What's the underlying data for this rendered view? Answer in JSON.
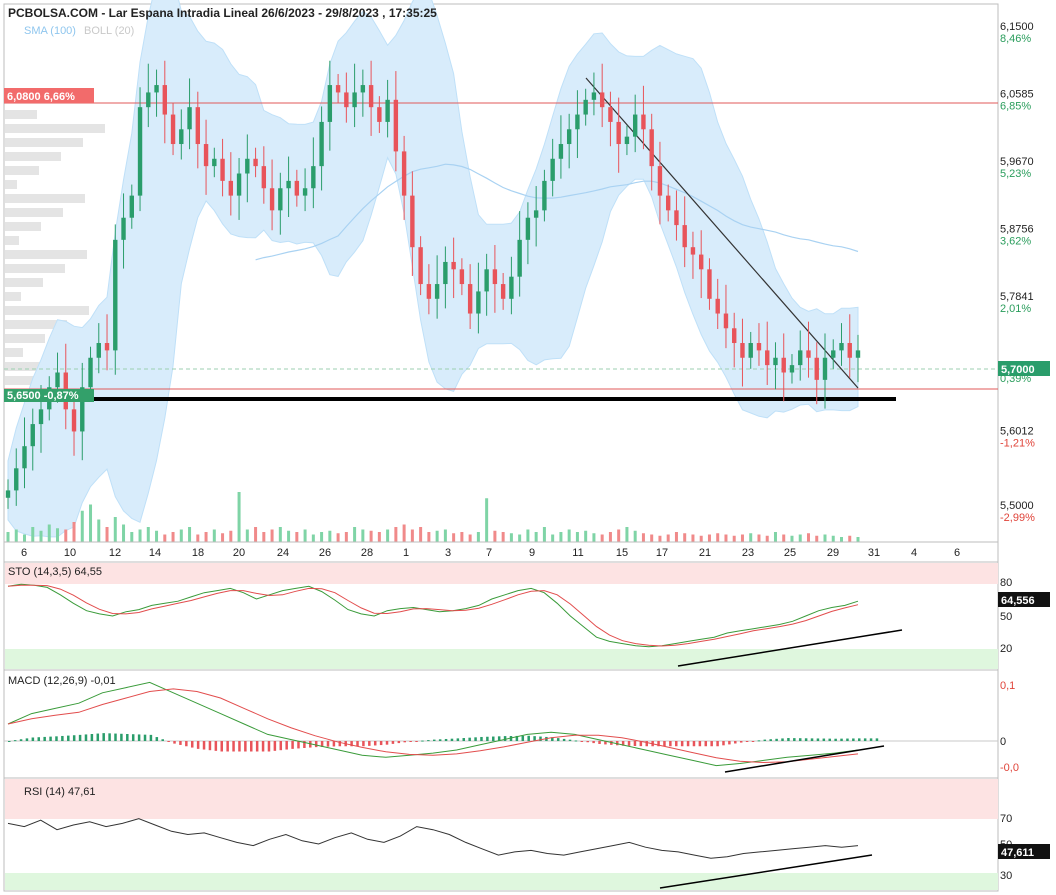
{
  "header": {
    "title": "PCBOLSA.COM - Lar Espana Intradia Lineal 26/6/2023 - 29/8/2023 , 17:35:25",
    "legend_sma": "SMA (100)",
    "legend_boll": "BOLL (20)"
  },
  "colors": {
    "up": "#2a9d6b",
    "down": "#e8545a",
    "band": "#d8ecfb",
    "sma": "#a9d2f2",
    "level": "#e05a5a",
    "label_red": "#f26b6b",
    "label_green": "#33a06a"
  },
  "left_labels": {
    "resistance": "6,0800  6,66%",
    "support": "5,6500  -0,87%"
  },
  "last_price": "5,7000",
  "last_price_pct": "0,39%",
  "price_axis": [
    {
      "v": 6.15,
      "label": "6,1500",
      "pct": "8,46%",
      "sign": "pos"
    },
    {
      "v": 6.0585,
      "label": "6,0585",
      "pct": "6,85%",
      "sign": "pos"
    },
    {
      "v": 5.967,
      "label": "5,9670",
      "pct": "5,23%",
      "sign": "pos"
    },
    {
      "v": 5.8756,
      "label": "5,8756",
      "pct": "3,62%",
      "sign": "pos"
    },
    {
      "v": 5.7841,
      "label": "5,7841",
      "pct": "2,01%",
      "sign": "pos"
    },
    {
      "v": 5.6012,
      "label": "5,6012",
      "pct": "-1,21%",
      "sign": "neg"
    },
    {
      "v": 5.5,
      "label": "5,5000",
      "pct": "-2,99%",
      "sign": "neg"
    }
  ],
  "x_ticks": [
    "6",
    "10",
    "12",
    "14",
    "18",
    "20",
    "24",
    "26",
    "28",
    "1",
    "3",
    "7",
    "9",
    "11",
    "15",
    "17",
    "21",
    "23",
    "25",
    "29",
    "31",
    "4",
    "6"
  ],
  "stoch": {
    "title": "STO (14,3,5)  64,55",
    "value_label": "64,556",
    "levels": [
      "80",
      "50",
      "20"
    ]
  },
  "macd": {
    "title": "MACD (12,26,9)  -0,01",
    "levels": [
      "0,1",
      "0",
      "-0,0"
    ]
  },
  "rsi": {
    "title": "RSI (14)  47,61",
    "value_label": "47,611",
    "levels": [
      "70",
      "50",
      "30"
    ]
  },
  "chart_data": {
    "type": "candlestick",
    "title": "PCBOLSA.COM - Lar Espana Intradia Lineal 26/6/2023 - 29/8/2023 , 17:35:25",
    "ylim": [
      5.45,
      6.18
    ],
    "levels": {
      "resistance": 6.08,
      "support": 5.65,
      "last": 5.7
    },
    "close": [
      5.52,
      5.55,
      5.58,
      5.61,
      5.63,
      5.66,
      5.68,
      5.63,
      5.6,
      5.66,
      5.7,
      5.72,
      5.71,
      5.86,
      5.89,
      5.92,
      6.04,
      6.06,
      6.07,
      6.03,
      5.99,
      6.01,
      6.04,
      5.99,
      5.96,
      5.97,
      5.94,
      5.92,
      5.95,
      5.97,
      5.96,
      5.93,
      5.9,
      5.93,
      5.94,
      5.92,
      5.93,
      5.96,
      6.02,
      6.07,
      6.06,
      6.04,
      6.06,
      6.07,
      6.04,
      6.02,
      6.05,
      5.98,
      5.92,
      5.85,
      5.8,
      5.78,
      5.8,
      5.83,
      5.82,
      5.8,
      5.76,
      5.79,
      5.82,
      5.8,
      5.78,
      5.81,
      5.86,
      5.89,
      5.9,
      5.94,
      5.97,
      5.99,
      6.01,
      6.03,
      6.05,
      6.06,
      6.04,
      6.02,
      5.99,
      6.0,
      6.03,
      6.01,
      5.96,
      5.92,
      5.9,
      5.88,
      5.85,
      5.84,
      5.82,
      5.78,
      5.76,
      5.74,
      5.72,
      5.7,
      5.72,
      5.71,
      5.69,
      5.7,
      5.68,
      5.69,
      5.71,
      5.7,
      5.67,
      5.7,
      5.71,
      5.72,
      5.7,
      5.71
    ],
    "volume": [
      8,
      10,
      6,
      12,
      9,
      14,
      11,
      10,
      16,
      25,
      30,
      18,
      12,
      20,
      14,
      8,
      10,
      12,
      9,
      6,
      8,
      10,
      12,
      6,
      8,
      10,
      7,
      9,
      40,
      10,
      12,
      8,
      10,
      12,
      9,
      8,
      10,
      6,
      8,
      9,
      7,
      8,
      12,
      10,
      9,
      8,
      10,
      12,
      14,
      10,
      12,
      8,
      9,
      10,
      7,
      8,
      6,
      8,
      35,
      9,
      8,
      7,
      6,
      10,
      8,
      12,
      6,
      8,
      10,
      8,
      9,
      7,
      6,
      8,
      10,
      12,
      9,
      7,
      6,
      5,
      6,
      8,
      7,
      6,
      5,
      6,
      7,
      6,
      5,
      6,
      7,
      6,
      5,
      8,
      6,
      5,
      6,
      7,
      5,
      6,
      5,
      4,
      5,
      4
    ],
    "stoch": [
      78,
      80,
      79,
      77,
      70,
      62,
      55,
      52,
      50,
      54,
      56,
      60,
      62,
      64,
      68,
      72,
      74,
      76,
      72,
      66,
      70,
      74,
      76,
      78,
      73,
      65,
      56,
      52,
      50,
      55,
      57,
      58,
      56,
      54,
      55,
      57,
      60,
      66,
      70,
      74,
      76,
      72,
      62,
      50,
      40,
      30,
      26,
      24,
      22,
      21,
      22,
      24,
      26,
      28,
      30,
      34,
      36,
      38,
      40,
      42,
      45,
      50,
      55,
      58,
      60,
      64
    ],
    "macd": [
      0.02,
      0.03,
      0.035,
      0.04,
      0.05,
      0.055,
      0.06,
      0.05,
      0.04,
      0.03,
      0.02,
      0.01,
      0.005,
      0.0,
      -0.005,
      -0.01,
      -0.012,
      -0.01,
      -0.008,
      -0.005,
      0.0,
      0.005,
      0.01,
      0.012,
      0.01,
      0.005,
      0.0,
      -0.005,
      -0.01,
      -0.015,
      -0.02,
      -0.018,
      -0.015,
      -0.012,
      -0.01,
      -0.008,
      -0.005
    ],
    "rsi": [
      62,
      60,
      64,
      58,
      61,
      63,
      60,
      62,
      65,
      61,
      57,
      55,
      56,
      53,
      50,
      48,
      52,
      55,
      51,
      49,
      53,
      56,
      52,
      50,
      54,
      60,
      58,
      55,
      50,
      46,
      42,
      44,
      45,
      43,
      42,
      44,
      46,
      48,
      50,
      47,
      45,
      44,
      42,
      40,
      41,
      43,
      44,
      45,
      46,
      47,
      48,
      47,
      48
    ]
  }
}
